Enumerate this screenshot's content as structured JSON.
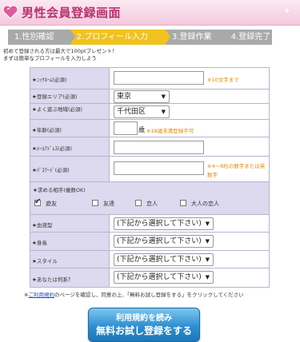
{
  "header": {
    "title": "男性会員登録画面"
  },
  "steps": [
    {
      "label": "1.性別確認"
    },
    {
      "label": "2.プロフィール入力"
    },
    {
      "label": "3.登録作業"
    },
    {
      "label": "4.登録完了"
    }
  ],
  "intro": {
    "line1": "初めて登録される方は最大で100ptプレゼント！",
    "line2": "まずは簡単なプロフィールを入力しよう"
  },
  "form": {
    "nickname": {
      "label": "★ﾆｯｸﾈｰﾑ(必須)",
      "value": "",
      "note": "※10文字まで"
    },
    "area": {
      "label": "★登録エリア(必須)",
      "value": "東京"
    },
    "city": {
      "label": "★よく遊ぶ地域(必須)",
      "value": "千代田区"
    },
    "age": {
      "label": "★年齢(必須)",
      "value": "",
      "unit": "歳",
      "note": "※18歳未満登録不可"
    },
    "email": {
      "label": "★ﾒｰﾙｱﾄﾞﾚｽ(必須)",
      "value": ""
    },
    "password": {
      "label": "★ﾊﾟｽﾜｰﾄﾞ(必須)",
      "value": "",
      "note": "※4〜8桁の数字または英数字"
    },
    "partner": {
      "label": "★求める相手(複数OK)",
      "options": [
        {
          "label": "遊友",
          "checked": true
        },
        {
          "label": "友達",
          "checked": false
        },
        {
          "label": "恋人",
          "checked": false
        },
        {
          "label": "大人の恋人",
          "checked": false
        }
      ]
    },
    "blood": {
      "label": "★血液型",
      "value": "(下記から選択して下さい)"
    },
    "height": {
      "label": "★身長",
      "value": "(下記から選択して下さい)"
    },
    "style": {
      "label": "★スタイル",
      "value": "(下記から選択して下さい)"
    },
    "type": {
      "label": "★あなたは何系？",
      "value": "(下記から選択して下さい)"
    }
  },
  "terms": {
    "prefix": "※",
    "link": "ご利用規約",
    "rest": "のページを確認し、同意の上、「無料お試し登録をする」をクリックしてください"
  },
  "cta": {
    "line1": "利用規約を読み",
    "line2": "無料お試し登録をする"
  },
  "colors": {
    "header_text": "#b8336f",
    "active_step": "#f1c21e",
    "note": "#e08a00",
    "button": "#2c8fd1"
  }
}
